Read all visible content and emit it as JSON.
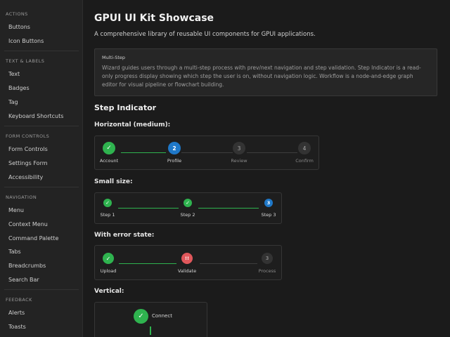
{
  "sidebar": {
    "sections": [
      {
        "title": "ACTIONS",
        "items": [
          "Buttons",
          "Icon Buttons"
        ]
      },
      {
        "title": "TEXT & LABELS",
        "items": [
          "Text",
          "Badges",
          "Tag",
          "Keyboard Shortcuts"
        ]
      },
      {
        "title": "FORM CONTROLS",
        "items": [
          "Form Controls",
          "Settings Form",
          "Accessibility"
        ]
      },
      {
        "title": "NAVIGATION",
        "items": [
          "Menu",
          "Context Menu",
          "Command Palette",
          "Tabs",
          "Breadcrumbs",
          "Search Bar"
        ]
      },
      {
        "title": "FEEDBACK",
        "items": [
          "Alerts",
          "Toasts"
        ]
      }
    ]
  },
  "main": {
    "title": "GPUI UI Kit Showcase",
    "subtitle": "A comprehensive library of reusable UI components for GPUI applications.",
    "info": {
      "title": "Multi-Step",
      "text": "Wizard guides users through a multi-step process with prev/next navigation and step validation. Step Indicator is a read-only progress display showing which step the user is on, without navigation logic. Workflow is a node-and-edge graph editor for visual pipeline or flowchart building."
    },
    "section_title": "Step Indicator",
    "horizontal": {
      "heading": "Horizontal (medium):",
      "steps": [
        {
          "label": "Account",
          "state": "complete",
          "mark": "✓"
        },
        {
          "label": "Profile",
          "state": "active",
          "mark": "2"
        },
        {
          "label": "Review",
          "state": "pending",
          "mark": "3"
        },
        {
          "label": "Confirm",
          "state": "pending",
          "mark": "4"
        }
      ]
    },
    "small": {
      "heading": "Small size:",
      "steps": [
        {
          "label": "Step 1",
          "state": "complete",
          "mark": "✓"
        },
        {
          "label": "Step 2",
          "state": "complete",
          "mark": "✓"
        },
        {
          "label": "Step 3",
          "state": "active",
          "mark": "3"
        }
      ]
    },
    "error": {
      "heading": "With error state:",
      "steps": [
        {
          "label": "Upload",
          "state": "complete",
          "mark": "✓"
        },
        {
          "label": "Validate",
          "state": "error",
          "mark": "!!"
        },
        {
          "label": "Process",
          "state": "pending",
          "mark": "3"
        }
      ]
    },
    "vertical": {
      "heading": "Vertical:",
      "steps": [
        {
          "label": "Connect",
          "state": "complete",
          "mark": "✓"
        }
      ]
    }
  },
  "colors": {
    "complete": "#2fb34f",
    "active": "#1f78c8",
    "error": "#e0575b",
    "pending": "#333333"
  }
}
